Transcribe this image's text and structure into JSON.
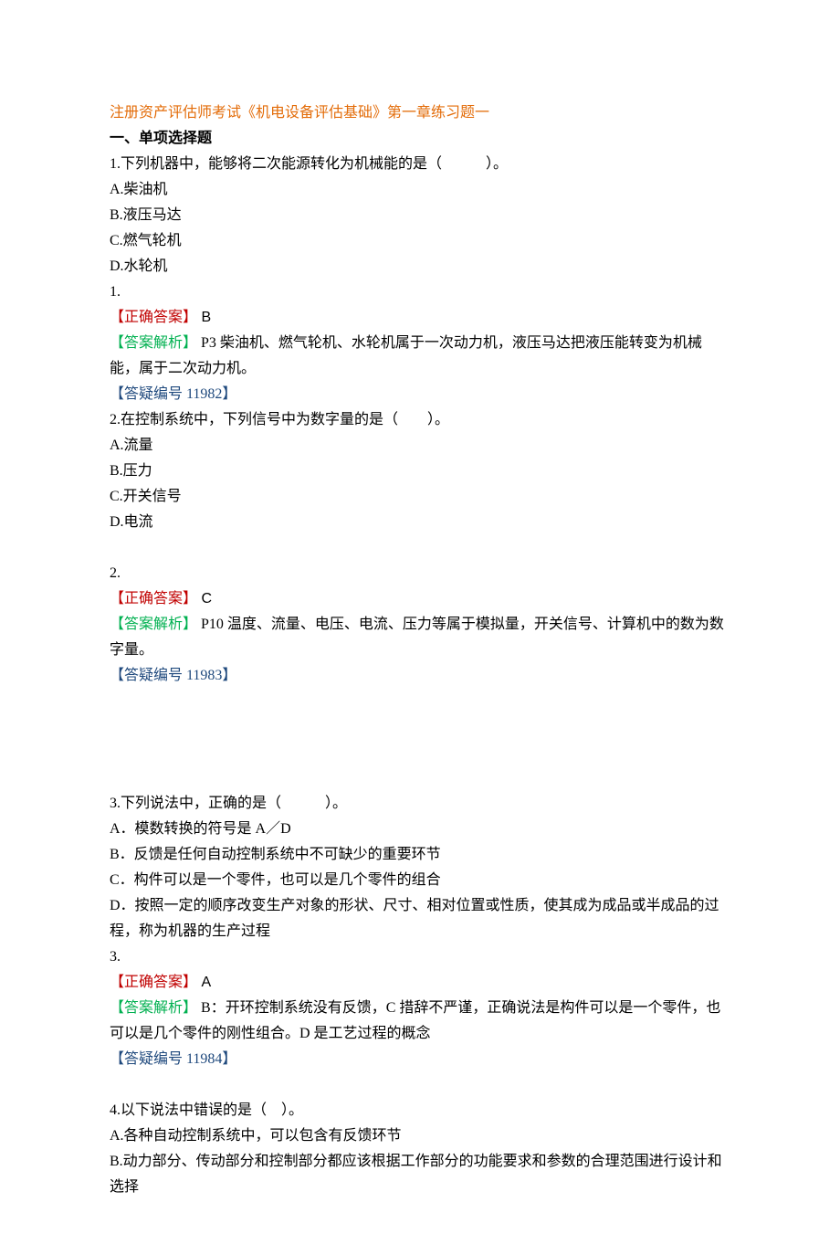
{
  "doc_title": "注册资产评估师考试《机电设备评估基础》第一章练习题一",
  "section1_heading": "一、单项选择题",
  "q1": {
    "stem": "1.下列机器中，能够将二次能源转化为机械能的是（　　　）。",
    "optA": "A.柴油机",
    "optB": "B.液压马达",
    "optC": "C.燃气轮机",
    "optD": "D.水轮机",
    "num_line": "1.",
    "correct_label": "【正确答案】",
    "correct_value": " B",
    "analysis_label": "【答案解析】",
    "analysis_text": " P3 柴油机、燃气轮机、水轮机属于一次动力机，液压马达把液压能转变为机械能，属于二次动力机。",
    "qa_number": "【答疑编号 11982】"
  },
  "q2": {
    "stem": "2.在控制系统中，下列信号中为数字量的是（　　）。",
    "optA": "A.流量",
    "optB": "B.压力",
    "optC": "C.开关信号",
    "optD": "D.电流",
    "num_line": "2.",
    "correct_label": "【正确答案】",
    "correct_value": " C",
    "analysis_label": "【答案解析】",
    "analysis_text": " P10 温度、流量、电压、电流、压力等属于模拟量，开关信号、计算机中的数为数字量。",
    "qa_number": "【答疑编号 11983】"
  },
  "q3": {
    "stem": "3.下列说法中，正确的是（　　　）。",
    "optA": "A．模数转换的符号是 A／D",
    "optB": "B．反馈是任何自动控制系统中不可缺少的重要环节",
    "optC": "C．构件可以是一个零件，也可以是几个零件的组合",
    "optD": "D．按照一定的顺序改变生产对象的形状、尺寸、相对位置或性质，使其成为成品或半成品的过程，称为机器的生产过程",
    "num_line": "3.",
    "correct_label": "【正确答案】",
    "correct_value": " A",
    "analysis_label": "【答案解析】",
    "analysis_text": " B：开环控制系统没有反馈，C 措辞不严谨，正确说法是构件可以是一个零件，也可以是几个零件的刚性组合。D 是工艺过程的概念",
    "qa_number": "【答疑编号 11984】"
  },
  "q4": {
    "stem": "4.以下说法中错误的是（　）。",
    "optA": "A.各种自动控制系统中，可以包含有反馈环节",
    "optB": "B.动力部分、传动部分和控制部分都应该根据工作部分的功能要求和参数的合理范围进行设计和选择"
  }
}
